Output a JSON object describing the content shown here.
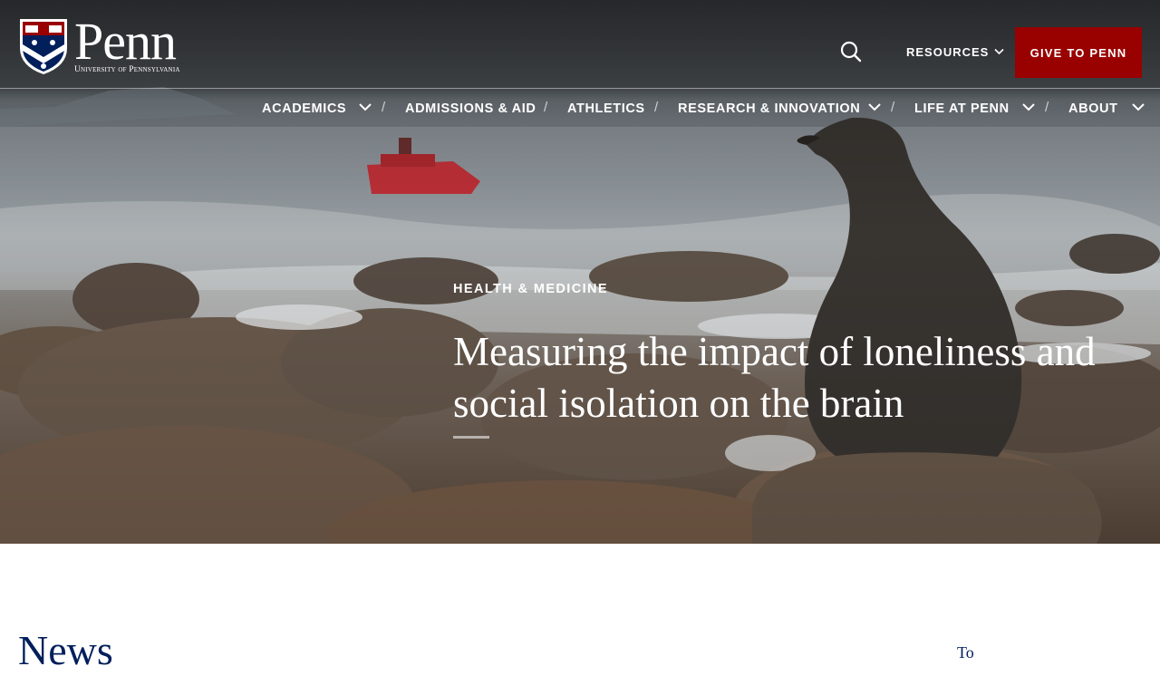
{
  "header": {
    "logo": {
      "wordmark": "Penn",
      "subtitle": "University of Pennsylvania"
    },
    "resources_label": "RESOURCES",
    "give_label": "GIVE TO PENN"
  },
  "nav": {
    "items": [
      {
        "label": "ACADEMICS",
        "has_dropdown": true
      },
      {
        "label": "ADMISSIONS & AID",
        "has_dropdown": false
      },
      {
        "label": "ATHLETICS",
        "has_dropdown": false
      },
      {
        "label": "RESEARCH & INNOVATION",
        "has_dropdown": true
      },
      {
        "label": "LIFE AT PENN",
        "has_dropdown": true
      },
      {
        "label": "ABOUT",
        "has_dropdown": true
      }
    ],
    "separator": "/"
  },
  "hero": {
    "category": "HEALTH & MEDICINE",
    "headline": "Measuring the impact of loneliness and social isolation on the brain",
    "image": "penguin chick on rocks with ship at sea"
  },
  "section": {
    "heading": "News",
    "side_heading": "To"
  },
  "colors": {
    "penn_red": "#990000",
    "penn_blue": "#011f5b",
    "text_on_dark": "#ffffff"
  },
  "icons": [
    "shield-logo-icon",
    "search-icon",
    "chevron-down-icon"
  ]
}
